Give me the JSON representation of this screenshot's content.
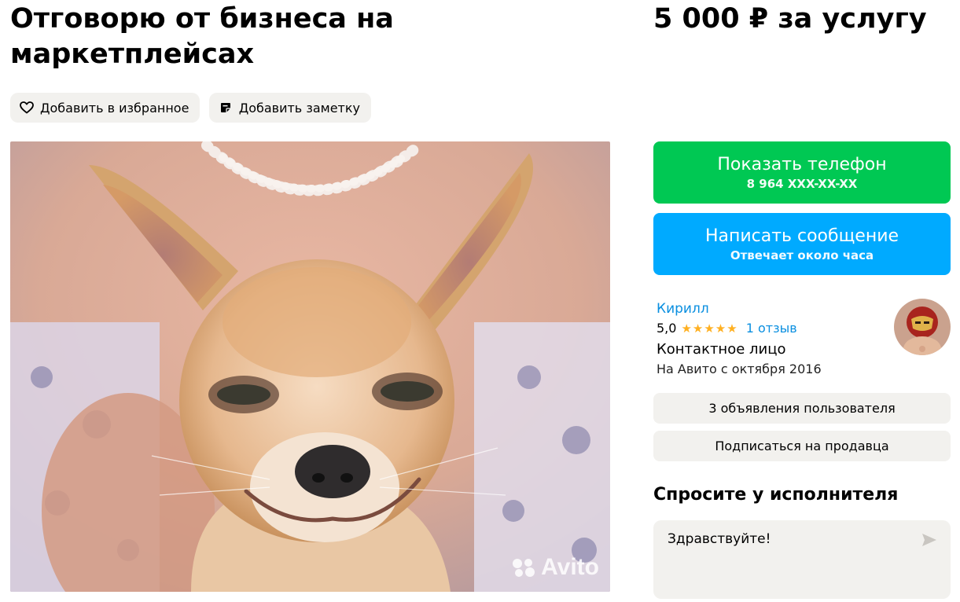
{
  "listing": {
    "title": "Отговорю от бизнеса на маркетплейсах",
    "price": "5 000 ₽ за услугу"
  },
  "actions": {
    "favorite_label": "Добавить в избранное",
    "note_label": "Добавить заметку"
  },
  "photo": {
    "watermark": "Avito"
  },
  "contact": {
    "call_label": "Показать телефон",
    "phone_masked": "8 964 XXX-XX-XX",
    "message_label": "Написать сообщение",
    "response_time": "Отвечает около часа"
  },
  "seller": {
    "name": "Кирилл",
    "rating": "5,0",
    "stars": "★★★★★",
    "reviews": "1 отзыв",
    "role": "Контактное лицо",
    "since": "На Авито с октября 2016",
    "ads_button": "3 объявления пользователя",
    "subscribe_button": "Подписаться на продавца"
  },
  "ask": {
    "title": "Спросите у исполнителя",
    "message": "Здравствуйте!"
  },
  "colors": {
    "call": "#00c853",
    "message": "#00aaff",
    "link": "#0a8fe0",
    "star": "#ffb021",
    "chip_bg": "#f2f1ee"
  },
  "icons": {
    "favorite": "heart-icon",
    "note": "note-icon",
    "send": "send-icon",
    "watermark": "avito-logo-icon"
  }
}
